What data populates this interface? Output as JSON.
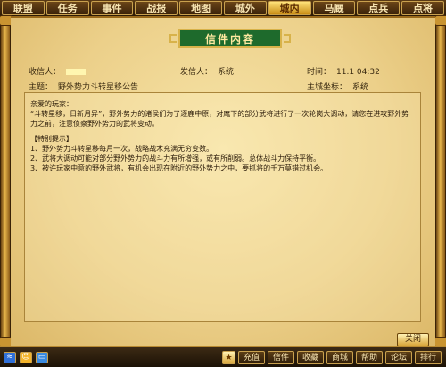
{
  "topnav": {
    "tabs": [
      {
        "label": "联盟"
      },
      {
        "label": "任务"
      },
      {
        "label": "事件"
      },
      {
        "label": "战报"
      },
      {
        "label": "地图"
      },
      {
        "label": "城外"
      },
      {
        "label": "城内"
      },
      {
        "label": "马厩"
      },
      {
        "label": "点兵"
      },
      {
        "label": "点将"
      }
    ],
    "active_tab": "城内"
  },
  "mail": {
    "title": "信件内容",
    "recipient_label": "收信人：",
    "sender_label": "发信人：",
    "sender_value": "系统",
    "time_label": "时间：",
    "time_value": "11.1  04:32",
    "subject_label": "主题：",
    "subject_value": "野外势力斗转星移公告",
    "main_city_label": "主城坐标：",
    "main_city_value": "系统",
    "body": {
      "greeting": "亲爱的玩家：",
      "para1": "“斗转星移，日新月异”，野外势力的诸侯们为了逐鹿中原，对麾下的部分武将进行了一次轮岗大调动，请您在进攻野外势力之前，注意侦察野外势力的武将变动。",
      "tips_header": "【特别提示】",
      "tip1": "1、野外势力斗转星移每月一次，战略战术充满无穷变数。",
      "tip2": "2、武将大调动可能对部分野外势力的战斗力有所增强，或有所削弱。总体战斗力保持平衡。",
      "tip3": "3、被许玩家中意的野外武将，有机会出现在附近的野外势力之中，要抓将的千万莫错过机会。"
    },
    "close_label": "关闭"
  },
  "bottombar": {
    "recharge_label": "充值",
    "mail_label": "信件",
    "collect_label": "收藏",
    "shop_label": "商城",
    "help_label": "帮助",
    "forum_label": "论坛",
    "rank_label": "排行"
  },
  "colors": {
    "accent_green": "#1e6a2c",
    "gold": "#d8b24a",
    "parchment": "#ecd08a"
  }
}
